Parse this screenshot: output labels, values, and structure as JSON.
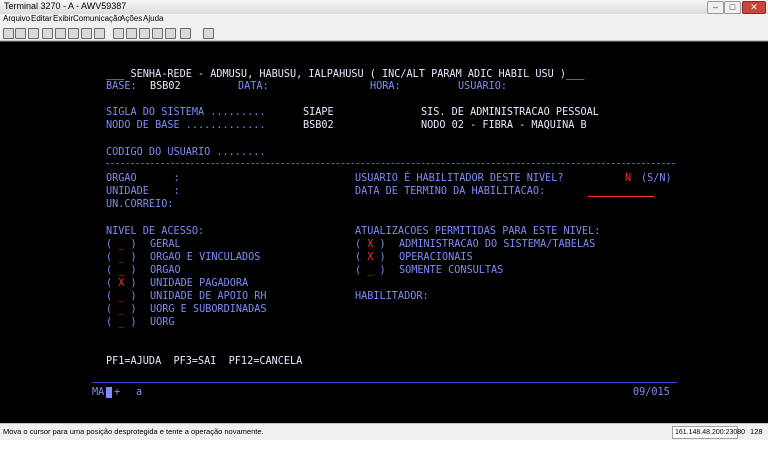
{
  "window": {
    "title": "Terminal 3270 - A - AWV59387",
    "min": "–",
    "max": "□",
    "close": "✕"
  },
  "menu": [
    "Arquivo",
    "Editar",
    "Exibir",
    "Comunicação",
    "Ações",
    "Ajuda"
  ],
  "screen": {
    "header": "___ SENHA-REDE - ADMUSU, HABUSU, IALPAHUSU ( INC/ALT PARAM ADIC HABIL USU )___",
    "base_label": "BASE:",
    "base_value": "BSB02",
    "data_label": "DATA:",
    "hora_label": "HORA:",
    "usuario_label": "USUARIO:",
    "sigla_label": "SIGLA DO SISTEMA .........",
    "sigla_value": "SIAPE",
    "sigla_desc": "SIS. DE ADMINISTRACAO PESSOAL",
    "nodo_label": "NODO DE BASE .............",
    "nodo_value": "BSB02",
    "nodo_desc": "NODO 02 - FIBRA - MAQUINA B",
    "codigo_label": "CODIGO DO USUARIO ........",
    "orgao_label": "ORGAO      :",
    "unidade_label": "UNIDADE    :",
    "uncorreio_label": "UN.CORREIO:",
    "habilitador_q": "USUARIO É HABILITADOR DESTE NIVEL?",
    "habilitador_value": "N",
    "habilitador_opts": "(S/N)",
    "termino_label": "DATA DE TERMINO DA HABILITACAO:",
    "nivel_title": "NIVEL DE ACESSO:",
    "nivel_items": [
      {
        "mark": "( _ )",
        "label": "GERAL"
      },
      {
        "mark": "( _ )",
        "label": "ORGAO E VINCULADOS"
      },
      {
        "mark": "( _ )",
        "label": "ORGAO"
      },
      {
        "mark": "( X )",
        "label": "UNIDADE PAGADORA"
      },
      {
        "mark": "( _ )",
        "label": "UNIDADE DE APOIO RH"
      },
      {
        "mark": "( _ )",
        "label": "UORG E SUBORDINADAS"
      },
      {
        "mark": "( _ )",
        "label": "UORG"
      }
    ],
    "atual_title": "ATUALIZACOES PERMITIDAS PARA ESTE NIVEL:",
    "atual_items": [
      {
        "mark": "( X )",
        "label": "ADMINISTRACAO DO SISTEMA/TABELAS"
      },
      {
        "mark": "( X )",
        "label": "OPERACIONAIS"
      },
      {
        "mark": "( _ )",
        "label": "SOMENTE CONSULTAS"
      }
    ],
    "habilitador_field_label": "HABILITADOR:",
    "pf_keys": "PF1=AJUDA  PF3=SAI  PF12=CANCELA",
    "oia_left": "MA",
    "oia_plus": "+",
    "oia_a": "a",
    "oia_pos": "09/015"
  },
  "status": {
    "message": "Mova o cursor para uma posição desprotegida e tente a operação novamente.",
    "ip": "161.148.48.200:23080",
    "count": "128"
  }
}
